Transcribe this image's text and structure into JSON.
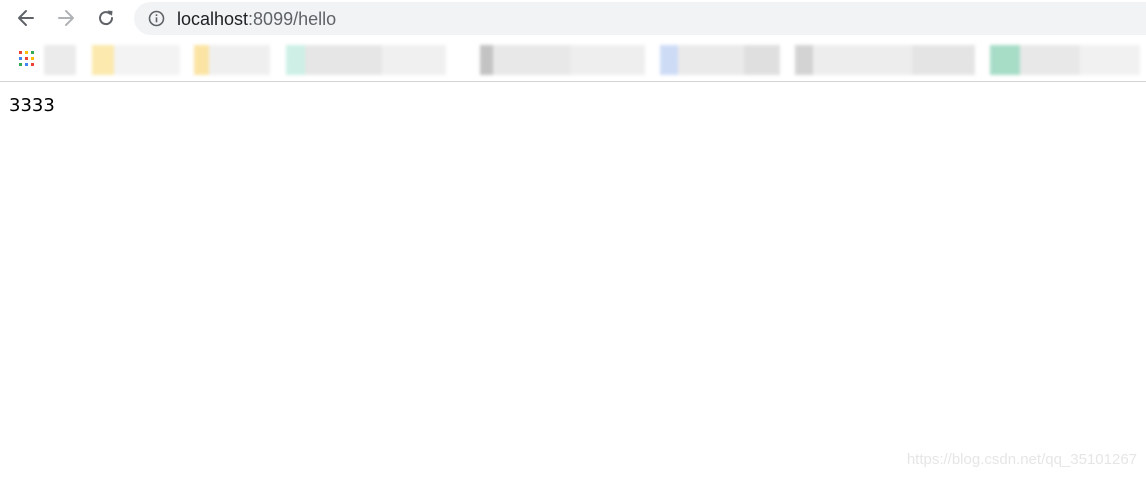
{
  "toolbar": {
    "back_icon": "arrow-left-icon",
    "forward_icon": "arrow-right-icon",
    "reload_icon": "reload-icon",
    "info_icon": "info-circle-icon"
  },
  "address_bar": {
    "host": "localhost",
    "rest": ":8099/hello"
  },
  "bookmarks_bar": {
    "apps_icon": "apps-grid-icon",
    "items_note_colors": [
      "#f3f3f3",
      "#fbe7a6",
      "#c8eee3",
      "#d8d8d8",
      "#c9d8f5",
      "#9ed9c2"
    ]
  },
  "page": {
    "body_text": "3333"
  },
  "watermark": {
    "text": "https://blog.csdn.net/qq_35101267"
  },
  "colors": {
    "omnibox_bg": "#f1f3f4",
    "nav_icon": "#5f6368",
    "nav_icon_disabled": "#b0b3b6",
    "divider": "#d4d4d4"
  }
}
